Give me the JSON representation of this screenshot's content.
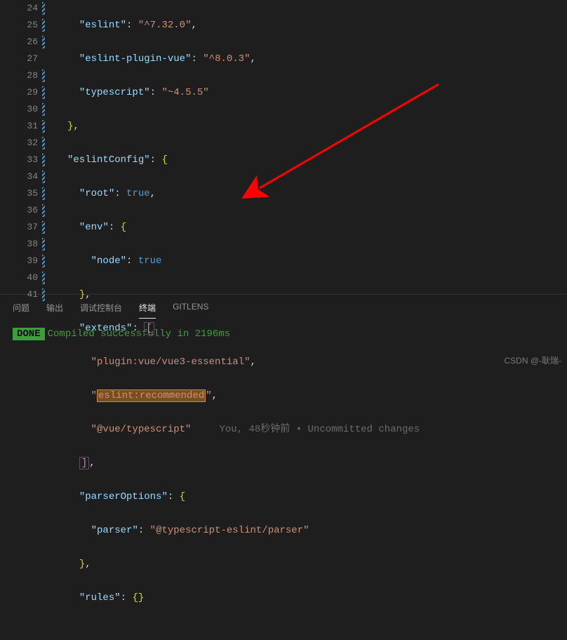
{
  "gutter": {
    "start": 24,
    "end": 41,
    "decorated": [
      24,
      25,
      26,
      28,
      29,
      30,
      31,
      32,
      33,
      34,
      35,
      36,
      37,
      38,
      39,
      40,
      41
    ]
  },
  "code": {
    "l24": {
      "k": "eslint",
      "v": "^7.32.0"
    },
    "l25": {
      "k": "eslint-plugin-vue",
      "v": "^8.0.3"
    },
    "l26": {
      "k": "typescript",
      "v": "~4.5.5"
    },
    "l28": {
      "k": "eslintConfig"
    },
    "l29": {
      "k": "root",
      "b": "true"
    },
    "l30": {
      "k": "env"
    },
    "l31": {
      "k": "node",
      "b": "true"
    },
    "l33": {
      "k": "extends"
    },
    "l34": {
      "v": "plugin:vue/vue3-essential"
    },
    "l35": {
      "v": "eslint:recommended"
    },
    "l36": {
      "v": "@vue/typescript"
    },
    "l38": {
      "k": "parserOptions"
    },
    "l39": {
      "k": "parser",
      "v": "@typescript-eslint/parser"
    },
    "l41": {
      "k": "rules"
    }
  },
  "gitlens": {
    "author": "You",
    "time": "48秒钟前",
    "msg": "Uncommitted changes"
  },
  "panel": {
    "tabs": [
      "问题",
      "输出",
      "调试控制台",
      "终端",
      "GITLENS"
    ],
    "active": 3
  },
  "terminal": {
    "badge": "DONE",
    "msg": "Compiled successfully in 2196ms"
  },
  "watermark": "CSDN @-耿瑞-"
}
